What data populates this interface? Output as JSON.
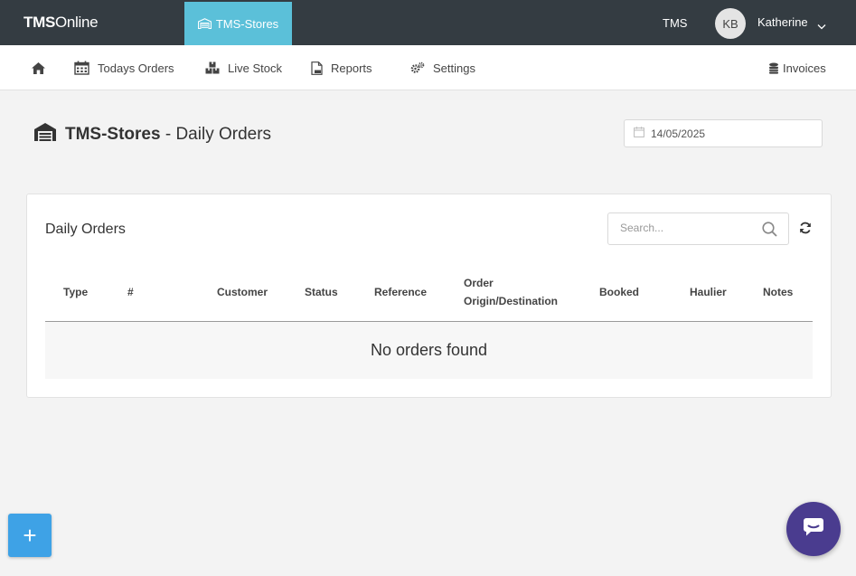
{
  "topbar": {
    "brand_bold": "TMS",
    "brand_rest": "Online",
    "store_tab": "TMS-Stores",
    "tms_link": "TMS",
    "avatar_initials": "KB",
    "user_name": "Katherine"
  },
  "nav": {
    "home_icon": "home-icon",
    "items": [
      {
        "label": "Todays Orders",
        "icon": "calendar-icon"
      },
      {
        "label": "Live Stock",
        "icon": "boxes-icon"
      },
      {
        "label": "Reports",
        "icon": "pdf-file-icon"
      },
      {
        "label": "Settings",
        "icon": "gears-icon"
      }
    ],
    "invoices": {
      "label": "Invoices",
      "icon": "coins-icon"
    }
  },
  "page": {
    "store_name": "TMS-Stores",
    "title_suffix": " - Daily Orders",
    "date_value": "14/05/2025"
  },
  "orders_card": {
    "title": "Daily Orders",
    "search_placeholder": "Search...",
    "columns": {
      "type": "Type",
      "number": "#",
      "customer": "Customer",
      "status": "Status",
      "reference": "Reference",
      "origin_line1": "Order",
      "origin_line2": "Origin/Destination",
      "booked": "Booked",
      "haulier": "Haulier",
      "notes": "Notes"
    },
    "empty_message": "No orders found"
  },
  "fab": {
    "add_label": "+"
  },
  "colors": {
    "topbar_bg": "#343c42",
    "store_tab_bg": "#5bc0d9",
    "fab_bg": "#3ea2e6",
    "chat_bg": "#4a3c8f"
  }
}
